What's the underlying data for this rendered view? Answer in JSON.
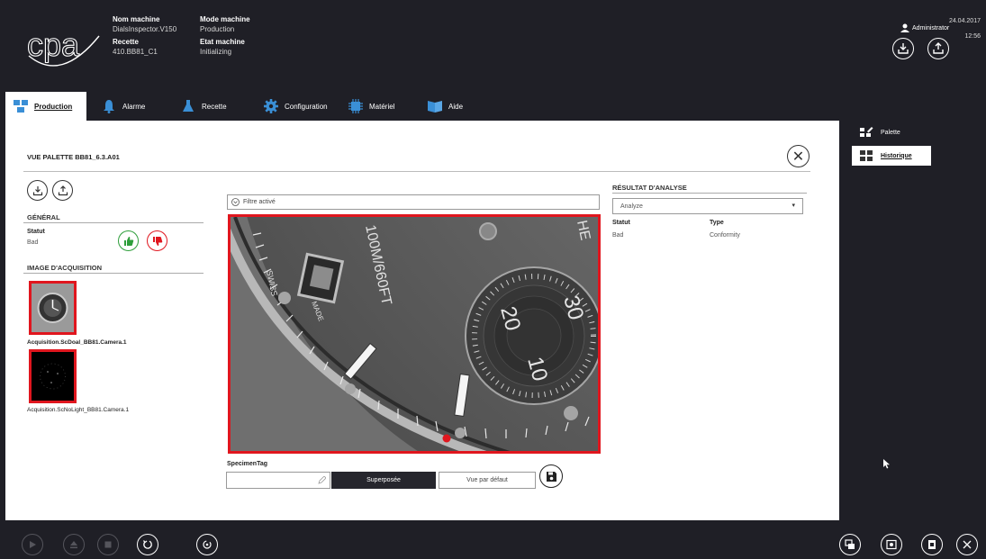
{
  "header": {
    "logo_text": "cpa",
    "machine_name_label": "Nom machine",
    "machine_name_value": "DialsInspector.V150",
    "recipe_label": "Recette",
    "recipe_value": "410.BB81_C1",
    "machine_mode_label": "Mode machine",
    "machine_mode_value": "Production",
    "machine_state_label": "Etat machine",
    "machine_state_value": "Initializing",
    "user": "Administrator",
    "date": "24.04.2017",
    "time": "12:56"
  },
  "tabs": [
    {
      "label": "Production",
      "icon": "boxes-icon",
      "active": true
    },
    {
      "label": "Alarme",
      "icon": "bell-icon"
    },
    {
      "label": "Recette",
      "icon": "flask-icon"
    },
    {
      "label": "Configuration",
      "icon": "gear-icon"
    },
    {
      "label": "Matériel",
      "icon": "chip-icon"
    },
    {
      "label": "Aide",
      "icon": "book-icon"
    }
  ],
  "page": {
    "title": "VUE PALETTE BB81_6.3.A01",
    "general": {
      "title": "GÉNÉRAL",
      "status_label": "Statut",
      "status_value": "Bad"
    },
    "acquisition": {
      "title": "IMAGE D'ACQUISITION",
      "items": [
        {
          "caption": "Acquisition.ScDoal_BB81.Camera.1"
        },
        {
          "caption": "Acquisition.ScNoLight_BB81.Camera.1"
        }
      ]
    },
    "filter_label": "Filtre activé",
    "image_text": {
      "depth": "100M/660FT",
      "swiss": "SWISS",
      "made": "MADE",
      "sub_20": "20",
      "sub_30": "30",
      "sub_10": "10",
      "corner": "HE"
    },
    "specimen_tag_label": "SpecimenTag",
    "specimen_tag_value": "",
    "overlay_button": "Superposée",
    "default_view_button": "Vue par défaut",
    "result": {
      "title": "RÉSULTAT D'ANALYSE",
      "dropdown_value": "Analyze",
      "status_label": "Statut",
      "status_value": "Bad",
      "type_label": "Type",
      "type_value": "Conformity"
    }
  },
  "side_panel": [
    {
      "label": "Palette",
      "icon": "palette-icon"
    },
    {
      "label": "Historique",
      "icon": "history-boxes-icon",
      "active": true
    }
  ],
  "colors": {
    "dark_bg": "#1f1f26",
    "accent_red": "#e0161e",
    "good_green": "#2e9e3b"
  }
}
